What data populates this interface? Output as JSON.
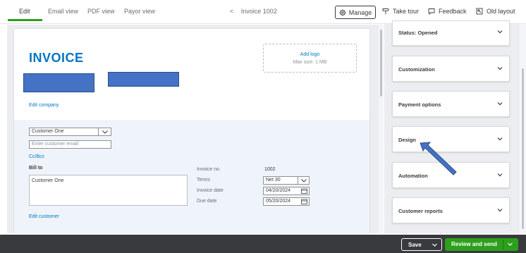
{
  "topbar": {
    "tabs": [
      {
        "label": "Edit",
        "active": true
      },
      {
        "label": "Email view",
        "active": false
      },
      {
        "label": "PDF view",
        "active": false
      },
      {
        "label": "Payor view",
        "active": false
      }
    ],
    "back_arrow": "<",
    "invoice_nav": "Invoice 1002",
    "manage_label": "Manage",
    "take_tour_label": "Take tour",
    "feedback_label": "Feedback",
    "old_layout_label": "Old layout"
  },
  "invoice": {
    "title": "INVOICE",
    "logo": {
      "add_label": "Add logo",
      "size_hint": "Max size: 1 MB"
    },
    "edit_company_link": "Edit company",
    "customer_select": "Customer One",
    "email_placeholder": "Enter customer email",
    "cc_bcc_link": "Cc/Bcc",
    "bill_to_label": "Bill to",
    "bill_to_value": "Customer One",
    "edit_customer_link": "Edit customer",
    "fields": {
      "invoice_no_label": "Invoice no.",
      "invoice_no_value": "1002",
      "terms_label": "Terms",
      "terms_value": "Net 30",
      "invoice_date_label": "Invoice date",
      "invoice_date_value": "04/20/2024",
      "due_date_label": "Due date",
      "due_date_value": "05/20/2024"
    }
  },
  "sidebar": {
    "sections": [
      {
        "label": "Status: Opened"
      },
      {
        "label": "Customization"
      },
      {
        "label": "Payment options"
      },
      {
        "label": "Design"
      },
      {
        "label": "Automation"
      },
      {
        "label": "Customer reports"
      }
    ]
  },
  "footer": {
    "save_label": "Save",
    "review_send_label": "Review and send"
  },
  "colors": {
    "accent_green": "#2ca01c",
    "link_blue": "#0077c5",
    "redaction_blue": "#4472c4",
    "annotation_arrow": "#4472c4"
  }
}
